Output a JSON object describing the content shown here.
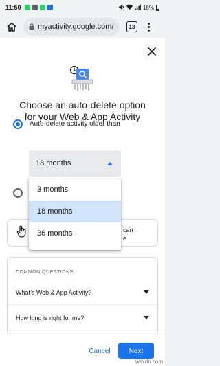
{
  "status_bar": {
    "time": "11:50",
    "battery": "18%"
  },
  "browser": {
    "url": "myactivity.google.com/",
    "tab_count": "13"
  },
  "dialog": {
    "title_line1": "Choose an auto-delete option",
    "title_line2": "for your Web & App Activity",
    "option_label": "Auto-delete activity older than",
    "selected_value": "18 months",
    "dropdown_options": [
      "3 months",
      "18 months",
      "36 months"
    ],
    "tip_text_1": "can",
    "tip_text_2": "e"
  },
  "faq": {
    "heading": "COMMON QUESTIONS",
    "items": [
      "What’s Web & App Activity?",
      "How long is right for me?"
    ]
  },
  "footer": {
    "cancel_label": "Cancel",
    "next_label": "Next"
  },
  "watermark": "wsxdn.com",
  "colors": {
    "accent": "#1a73e8",
    "selected_option_bg": "#d2e3fc"
  }
}
